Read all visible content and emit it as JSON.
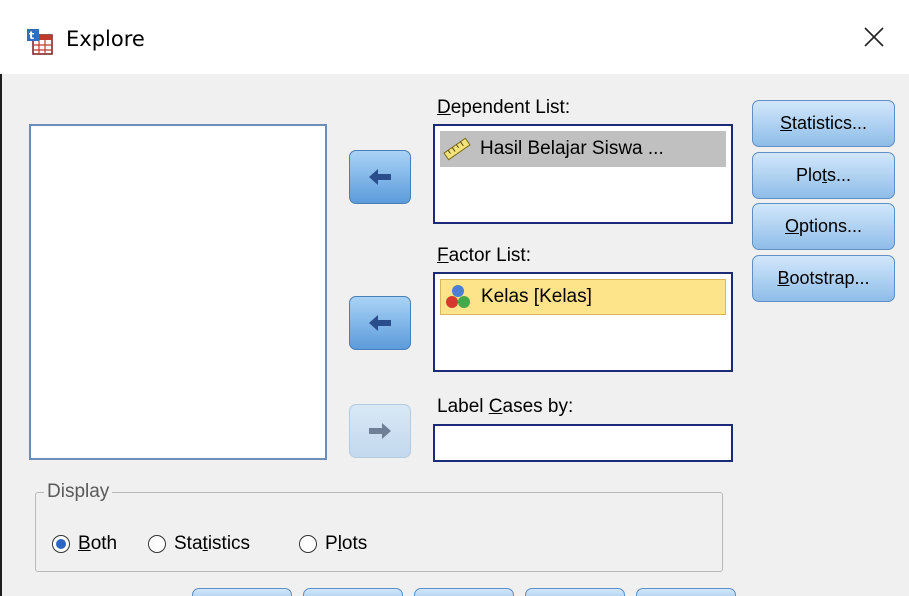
{
  "window": {
    "title": "Explore",
    "close_glyph": "✕"
  },
  "dependent_list": {
    "label_prefix": "",
    "label_ul": "D",
    "label_rest": "ependent List:",
    "items": [
      {
        "text": "Hasil Belajar Siswa ...",
        "icon": "ruler-scale-icon"
      }
    ]
  },
  "factor_list": {
    "label_ul": "F",
    "label_rest": "actor List:",
    "items": [
      {
        "text": "Kelas [Kelas]",
        "icon": "nominal-variable-icon"
      }
    ]
  },
  "label_cases": {
    "label_prefix": "Label ",
    "label_ul": "C",
    "label_rest": "ases by:",
    "value": ""
  },
  "buttons": {
    "statistics": {
      "ul": "S",
      "rest": "tatistics..."
    },
    "plots": {
      "pre": "Plo",
      "ul": "t",
      "rest": "s..."
    },
    "options": {
      "ul": "O",
      "rest": "ptions..."
    },
    "bootstrap": {
      "ul": "B",
      "rest": "ootstrap..."
    }
  },
  "display": {
    "title": "Display",
    "options": [
      {
        "pre": "",
        "ul": "B",
        "rest": "oth",
        "selected": true
      },
      {
        "pre": "Sta",
        "ul": "t",
        "rest": "istics",
        "selected": false
      },
      {
        "pre": "P",
        "ul": "l",
        "rest": "ots",
        "selected": false
      }
    ]
  },
  "colors": {
    "accent": "#2b66c6",
    "button_top": "#d2e7fb",
    "button_bottom": "#8ebde8",
    "list_border": "#1c2a7a"
  }
}
